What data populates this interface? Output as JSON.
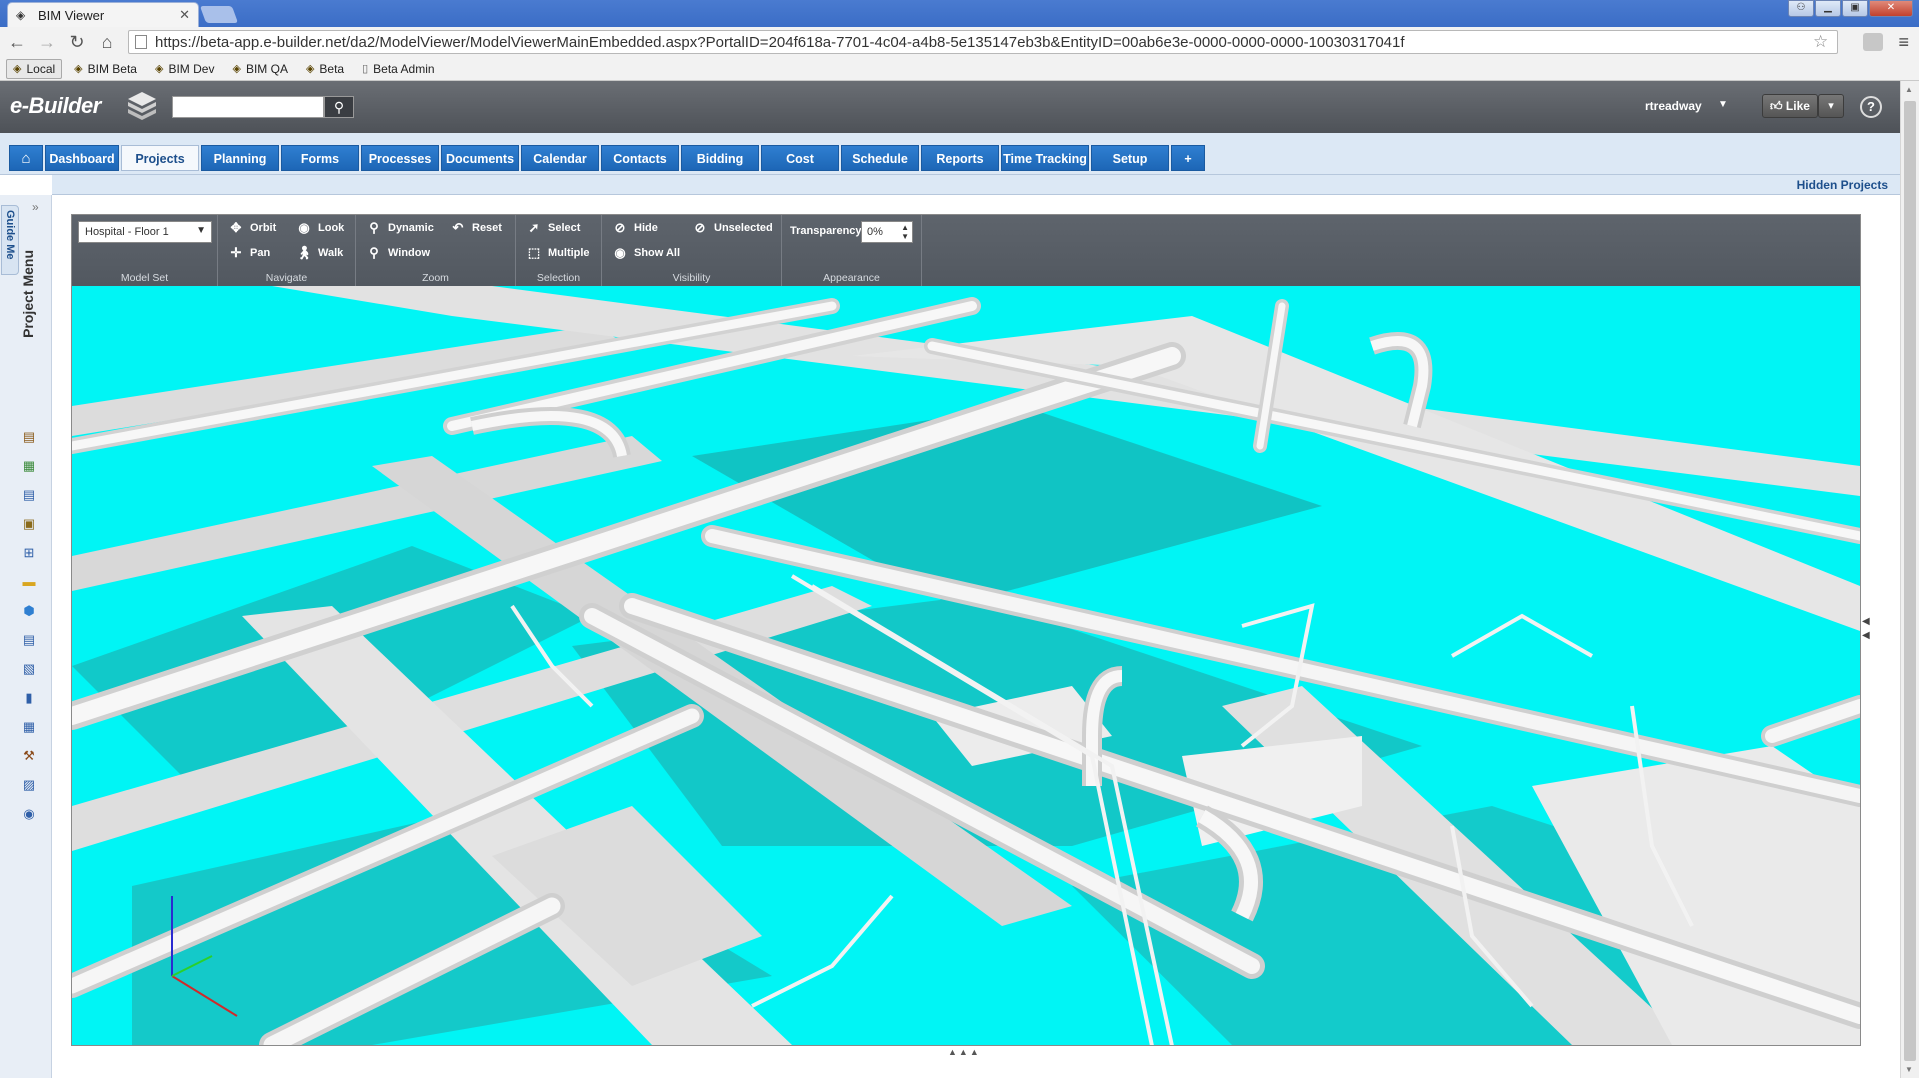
{
  "browser": {
    "tab_title": "BIM Viewer",
    "tab_close": "✕",
    "url": "https://beta-app.e-builder.net/da2/ModelViewer/ModelViewerMainEmbedded.aspx?PortalID=204f618a-7701-4c04-a4b8-5e135147eb3b&EntityID=00ab6e3e-0000-0000-0000-10030317041f",
    "bookmarks": [
      "Local",
      "BIM Beta",
      "BIM Dev",
      "BIM QA",
      "Beta",
      "Beta Admin"
    ]
  },
  "header": {
    "logo": "e-Builder",
    "search_placeholder": "",
    "user": "rtreadway",
    "like_label": "Like"
  },
  "nav": {
    "tabs": [
      "Dashboard",
      "Projects",
      "Planning",
      "Forms",
      "Processes",
      "Documents",
      "Calendar",
      "Contacts",
      "Bidding",
      "Cost",
      "Schedule",
      "Reports",
      "Time Tracking",
      "Setup"
    ],
    "active": "Projects",
    "plus": "+",
    "hidden_projects": "Hidden Projects"
  },
  "sidebar": {
    "guide_me": "Guide Me",
    "project_menu": "Project Menu"
  },
  "toolbar": {
    "model_set_value": "Hospital - Floor 1",
    "groups": {
      "model_set": "Model Set",
      "navigate": "Navigate",
      "zoom": "Zoom",
      "selection": "Selection",
      "visibility": "Visibility",
      "appearance": "Appearance"
    },
    "buttons": {
      "orbit": "Orbit",
      "look": "Look",
      "pan": "Pan",
      "walk": "Walk",
      "dynamic": "Dynamic",
      "reset": "Reset",
      "window": "Window",
      "select": "Select",
      "multiple": "Multiple",
      "hide": "Hide",
      "unselected": "Unselected",
      "show_all": "Show All"
    },
    "transparency_label": "Transparency:",
    "transparency_value": "0%"
  },
  "colors": {
    "nav_tab": "#1d66b6",
    "model_cyan": "#00ffff",
    "model_dark_cyan": "#1ab8b8",
    "pipe_white": "#f2f2f2"
  }
}
